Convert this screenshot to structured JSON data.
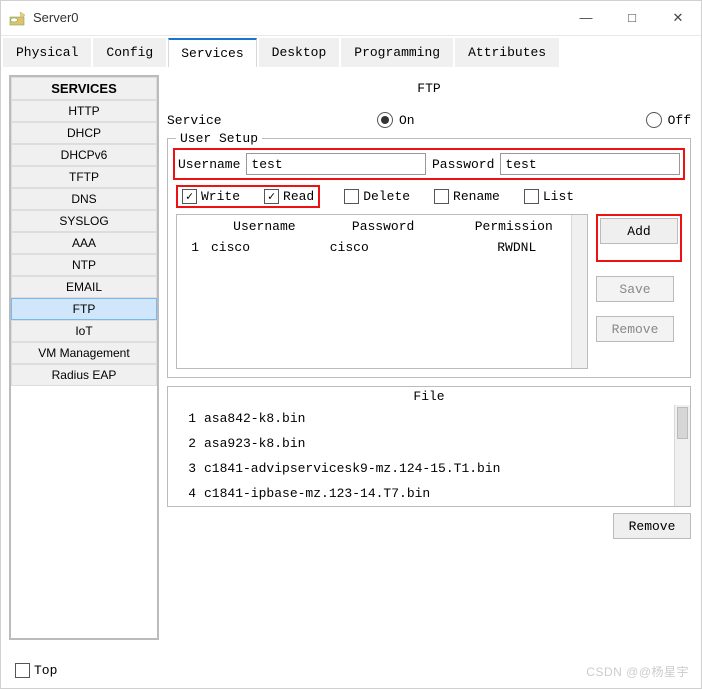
{
  "window": {
    "title": "Server0"
  },
  "win_controls": {
    "min": "—",
    "max": "□",
    "close": "✕"
  },
  "tabs": {
    "physical": "Physical",
    "config": "Config",
    "services": "Services",
    "desktop": "Desktop",
    "programming": "Programming",
    "attributes": "Attributes"
  },
  "sidebar": {
    "header": "SERVICES",
    "items": [
      "HTTP",
      "DHCP",
      "DHCPv6",
      "TFTP",
      "DNS",
      "SYSLOG",
      "AAA",
      "NTP",
      "EMAIL",
      "FTP",
      "IoT",
      "VM Management",
      "Radius EAP"
    ],
    "selected": "FTP"
  },
  "ftp": {
    "title": "FTP",
    "service_label": "Service",
    "on_label": "On",
    "off_label": "Off",
    "state": "on",
    "user_setup_legend": "User Setup",
    "username_label": "Username",
    "username_value": "test",
    "password_label": "Password",
    "password_value": "test",
    "perms": {
      "write": "Write",
      "read": "Read",
      "delete": "Delete",
      "rename": "Rename",
      "list": "List",
      "write_checked": true,
      "read_checked": true,
      "delete_checked": false,
      "rename_checked": false,
      "list_checked": false
    },
    "table": {
      "col_user": "Username",
      "col_pass": "Password",
      "col_perm": "Permission",
      "rows": [
        {
          "n": "1",
          "user": "cisco",
          "pass": "cisco",
          "perm": "RWDNL"
        }
      ]
    },
    "buttons": {
      "add": "Add",
      "save": "Save",
      "remove": "Remove"
    },
    "filelist": {
      "header": "File",
      "rows": [
        {
          "n": "1",
          "name": "asa842-k8.bin"
        },
        {
          "n": "2",
          "name": "asa923-k8.bin"
        },
        {
          "n": "3",
          "name": "c1841-advipservicesk9-mz.124-15.T1.bin"
        },
        {
          "n": "4",
          "name": "c1841-ipbase-mz.123-14.T7.bin"
        }
      ],
      "remove_label": "Remove"
    }
  },
  "bottom": {
    "top_label": "Top"
  },
  "watermark": "CSDN @@杨星宇"
}
